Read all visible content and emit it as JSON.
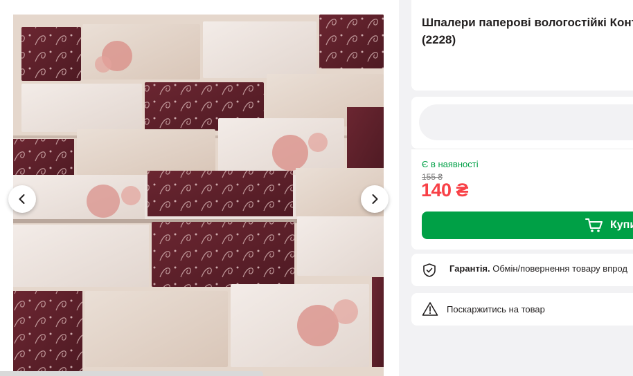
{
  "product": {
    "title": "Шпалери паперові вологостійкі Конт\n(2228)",
    "stock_status": "Є в наявності",
    "old_price": "155 ₴",
    "price": "140 ₴",
    "buy_label": "Купи"
  },
  "warranty": {
    "title": "Гарантія.",
    "text": "Обмін/повернення товару впрод"
  },
  "complaint": {
    "label": "Поскаржитись на товар"
  },
  "icons": {
    "prev": "chevron-left-icon",
    "next": "chevron-right-icon",
    "cart": "cart-icon",
    "shield": "shield-check-icon",
    "warning": "warning-triangle-icon"
  },
  "colors": {
    "accent_green": "#00a046",
    "price_red": "#f84147",
    "text_dark": "#221f1f"
  }
}
